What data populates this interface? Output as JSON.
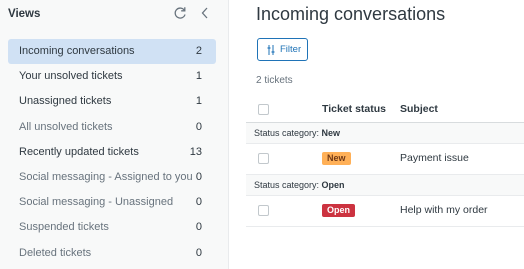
{
  "sidebar": {
    "title": "Views",
    "items": [
      {
        "label": "Incoming conversations",
        "count": "2",
        "active": true,
        "muted": false
      },
      {
        "label": "Your unsolved tickets",
        "count": "1",
        "active": false,
        "muted": false
      },
      {
        "label": "Unassigned tickets",
        "count": "1",
        "active": false,
        "muted": false
      },
      {
        "label": "All unsolved tickets",
        "count": "0",
        "active": false,
        "muted": true
      },
      {
        "label": "Recently updated tickets",
        "count": "13",
        "active": false,
        "muted": false
      },
      {
        "label": "Social messaging - Assigned to you",
        "count": "0",
        "active": false,
        "muted": true
      },
      {
        "label": "Social messaging - Unassigned",
        "count": "0",
        "active": false,
        "muted": true
      },
      {
        "label": "Suspended tickets",
        "count": "0",
        "active": false,
        "muted": true
      },
      {
        "label": "Deleted tickets",
        "count": "0",
        "active": false,
        "muted": true
      }
    ],
    "icons": {
      "refresh": "refresh-icon",
      "collapse": "chevron-left-icon"
    }
  },
  "main": {
    "title": "Incoming conversations",
    "filter_label": "Filter",
    "ticket_count": "2 tickets",
    "columns": {
      "status": "Ticket status",
      "subject": "Subject"
    },
    "groups": [
      {
        "prefix": "Status category: ",
        "name": "New",
        "tickets": [
          {
            "status": "New",
            "subject": "Payment issue",
            "badge_bg": "#ffb057",
            "badge_fg": "#703815"
          }
        ]
      },
      {
        "prefix": "Status category: ",
        "name": "Open",
        "tickets": [
          {
            "status": "Open",
            "subject": "Help with my order",
            "badge_bg": "#cc3340",
            "badge_fg": "#ffffff"
          }
        ]
      }
    ]
  },
  "colors": {
    "accent": "#1f73b7",
    "active_bg": "#d0e1f4"
  }
}
